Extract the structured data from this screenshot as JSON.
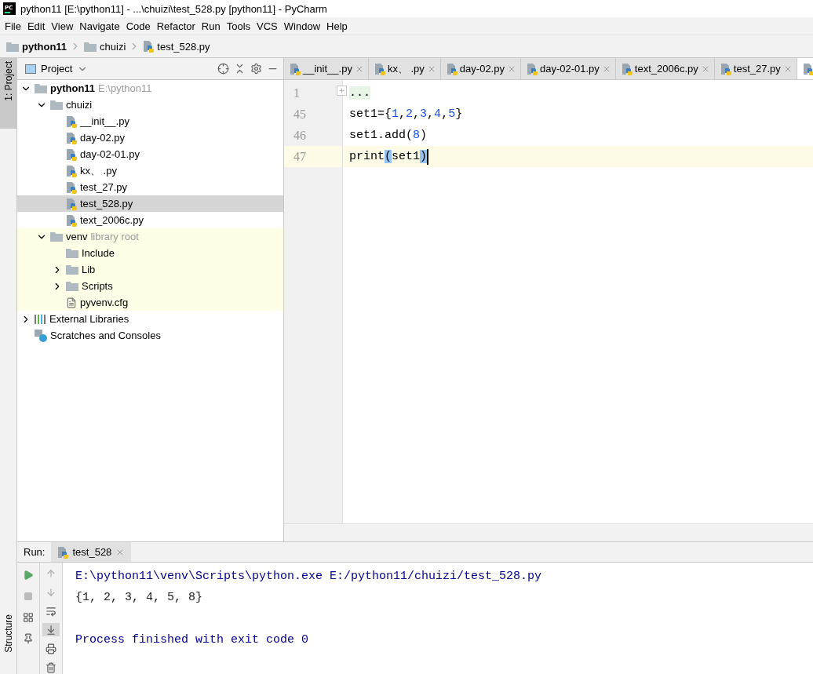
{
  "window": {
    "logo": "PC",
    "title": "python11 [E:\\python11] - ...\\chuizi\\test_528.py [python11] - PyCharm"
  },
  "menu": [
    "File",
    "Edit",
    "View",
    "Navigate",
    "Code",
    "Refactor",
    "Run",
    "Tools",
    "VCS",
    "Window",
    "Help"
  ],
  "breadcrumbs": [
    {
      "label": "python11",
      "kind": "project"
    },
    {
      "label": "chuizi",
      "kind": "folder"
    },
    {
      "label": "test_528.py",
      "kind": "py"
    }
  ],
  "side_tabs": [
    {
      "label": "1: Project",
      "selected": true
    },
    {
      "label": "Structure",
      "selected": false
    }
  ],
  "project_panel": {
    "title": "Project",
    "tree": [
      {
        "label": "python11",
        "hint": "E:\\python11",
        "kind": "project",
        "expanded": true,
        "selected": false,
        "children": [
          {
            "label": "chuizi",
            "kind": "folder",
            "expanded": true,
            "selected": false,
            "children": [
              {
                "label": "__init__.py",
                "kind": "py",
                "selected": false
              },
              {
                "label": "day-02.py",
                "kind": "py",
                "selected": false
              },
              {
                "label": "day-02-01.py",
                "kind": "py",
                "selected": false
              },
              {
                "label": "kx、 .py",
                "kind": "py",
                "selected": false
              },
              {
                "label": "test_27.py",
                "kind": "py",
                "selected": false
              },
              {
                "label": "test_528.py",
                "kind": "py",
                "selected": true
              },
              {
                "label": "text_2006c.py",
                "kind": "py",
                "selected": false
              }
            ]
          },
          {
            "label": "venv",
            "hint": "library root",
            "kind": "folder",
            "library_root": true,
            "expanded": true,
            "selected": false,
            "children": [
              {
                "label": "Include",
                "kind": "folder",
                "selected": false
              },
              {
                "label": "Lib",
                "kind": "folder",
                "expanded": false,
                "selected": false
              },
              {
                "label": "Scripts",
                "kind": "folder",
                "expanded": false,
                "selected": false
              },
              {
                "label": "pyvenv.cfg",
                "kind": "cfg",
                "selected": false
              }
            ]
          }
        ]
      },
      {
        "label": "External Libraries",
        "kind": "library",
        "expanded": false,
        "selected": false
      },
      {
        "label": "Scratches and Consoles",
        "kind": "scratches",
        "selected": false
      }
    ]
  },
  "editor_tabs": [
    {
      "label": "__init__.py",
      "selected": false
    },
    {
      "label": "kx、 .py",
      "selected": false
    },
    {
      "label": "day-02.py",
      "selected": false
    },
    {
      "label": "day-02-01.py",
      "selected": false
    },
    {
      "label": "text_2006c.py",
      "selected": false
    },
    {
      "label": "test_27.py",
      "selected": false
    },
    {
      "selected": true
    }
  ],
  "code": [
    {
      "number": "1",
      "folded": true,
      "current": false,
      "tokens": [
        {
          "text": "...",
          "kind": "fold"
        }
      ]
    },
    {
      "number": "45",
      "current": false,
      "tokens": [
        {
          "text": "set1={",
          "kind": "plain"
        },
        {
          "text": "1",
          "kind": "number"
        },
        {
          "text": ",",
          "kind": "plain"
        },
        {
          "text": "2",
          "kind": "number"
        },
        {
          "text": ",",
          "kind": "plain"
        },
        {
          "text": "3",
          "kind": "number"
        },
        {
          "text": ",",
          "kind": "plain"
        },
        {
          "text": "4",
          "kind": "number"
        },
        {
          "text": ",",
          "kind": "plain"
        },
        {
          "text": "5",
          "kind": "number"
        },
        {
          "text": "}",
          "kind": "plain"
        }
      ]
    },
    {
      "number": "46",
      "current": false,
      "tokens": [
        {
          "text": "set1.add(",
          "kind": "plain"
        },
        {
          "text": "8",
          "kind": "number"
        },
        {
          "text": ")",
          "kind": "plain"
        }
      ]
    },
    {
      "number": "47",
      "current": true,
      "tokens": [
        {
          "text": "print",
          "kind": "plain"
        },
        {
          "text": "(",
          "kind": "match"
        },
        {
          "text": "set1",
          "kind": "plain"
        },
        {
          "text": ")",
          "kind": "match"
        }
      ]
    }
  ],
  "run_panel": {
    "label": "Run:",
    "tab": "test_528",
    "console": [
      {
        "text": "E:\\python11\\venv\\Scripts\\python.exe E:/python11/chuizi/test_528.py",
        "kind": "command"
      },
      {
        "text": "{1, 2, 3, 4, 5, 8}",
        "kind": "output"
      },
      {
        "kind": "blank"
      },
      {
        "text": "Process finished with exit code 0",
        "kind": "status"
      }
    ]
  }
}
